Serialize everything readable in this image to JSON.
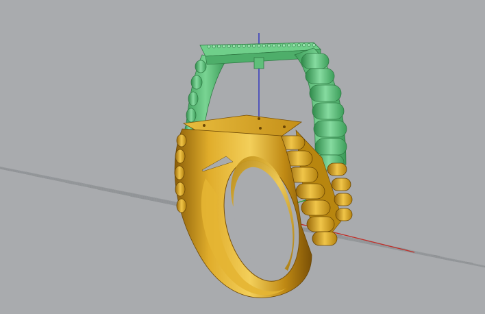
{
  "viewport": {
    "view_kind": "perspective",
    "background": "#a9abae",
    "grid_color": "#8c8f92",
    "grid_minor_color": "#9b9ea1",
    "x_axis_color": "#c0302a",
    "y_axis_color": "#2a9a2a",
    "z_axis_color": "#2b2fbf"
  },
  "models": [
    {
      "name": "top-crown",
      "material": "green",
      "color": "#5fbf7a"
    },
    {
      "name": "ring-shank",
      "material": "gold",
      "color": "#d6a11c"
    }
  ]
}
